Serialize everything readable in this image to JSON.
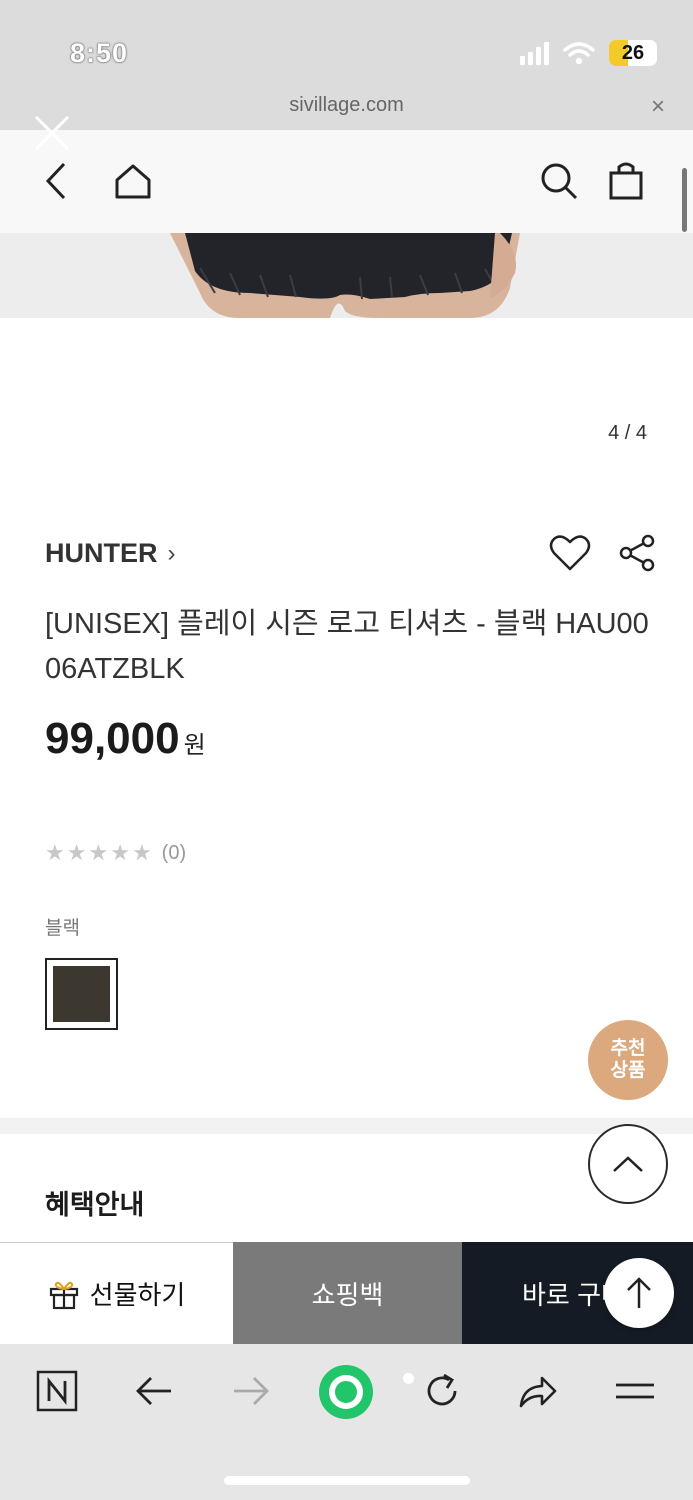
{
  "status_bar": {
    "time": "8:50",
    "battery": "26"
  },
  "browser": {
    "url": "sivillage.com",
    "close_symbol": "×"
  },
  "gallery": {
    "counter": "4 / 4"
  },
  "product": {
    "brand": "HUNTER",
    "brand_chevron": "›",
    "title": "[UNISEX] 플레이 시즌 로고 티셔츠 - 블랙 HAU0006ATZBLK",
    "price": "99,000",
    "price_unit": "원",
    "rating_stars": [
      "★",
      "★",
      "★",
      "★",
      "★"
    ],
    "rating_value": 0,
    "review_count": "(0)",
    "color_label": "블랙",
    "swatch_color": "#3c3830"
  },
  "floating": {
    "recommend_line1": "추천",
    "recommend_line2": "상품"
  },
  "sections": {
    "benefit_title": "혜택안내"
  },
  "action_bar": {
    "gift": "선물하기",
    "shopping_bag": "쇼핑백",
    "buy_now": "바로 구매"
  },
  "colors": {
    "accent_recommend": "#dca97e",
    "buy_bg": "#151b24",
    "bag_bg": "#7a7a7a",
    "browser_green": "#22c56a"
  },
  "icons": {
    "header": [
      "back-icon",
      "home-icon",
      "search-icon",
      "shopping-bag-icon"
    ],
    "toolbar": [
      "naver-n-icon",
      "arrow-left-icon",
      "arrow-right-icon",
      "green-circle-icon",
      "refresh-icon",
      "share-icon",
      "menu-icon"
    ]
  }
}
